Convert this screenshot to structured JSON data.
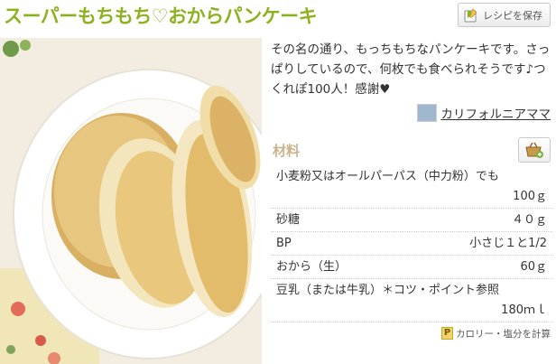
{
  "recipe": {
    "title": "スーパーもちもち♡おからパンケーキ",
    "save_button": "レシピを保存",
    "description": "その名の通り、もっちもちなパンケーキです。さっぱりしているので、何枚でも食べられそうです♪つくれぽ100人！感謝♥",
    "author": "カリフォルニアママ",
    "ingredients_label": "材料",
    "ingredients": [
      {
        "name": "小麦粉又はオールパーパス（中力粉）でも",
        "qty": "100ｇ"
      },
      {
        "name": "砂糖",
        "qty": "４０ｇ"
      },
      {
        "name": "BP",
        "qty": "小さじ１と1/2"
      },
      {
        "name": "おから（生）",
        "qty": "60ｇ"
      },
      {
        "name": "豆乳（または牛乳）＊コツ・ポイント参照",
        "qty": "180ｍｌ"
      }
    ],
    "calorie_button": "カロリー・塩分を計算"
  },
  "colors": {
    "title_green": "#8cb21f",
    "ingredients_label": "#c9b48a"
  },
  "icons": {
    "save": "bookmark-save-icon",
    "cart": "shopping-basket-icon",
    "calorie": "p-point-icon"
  }
}
